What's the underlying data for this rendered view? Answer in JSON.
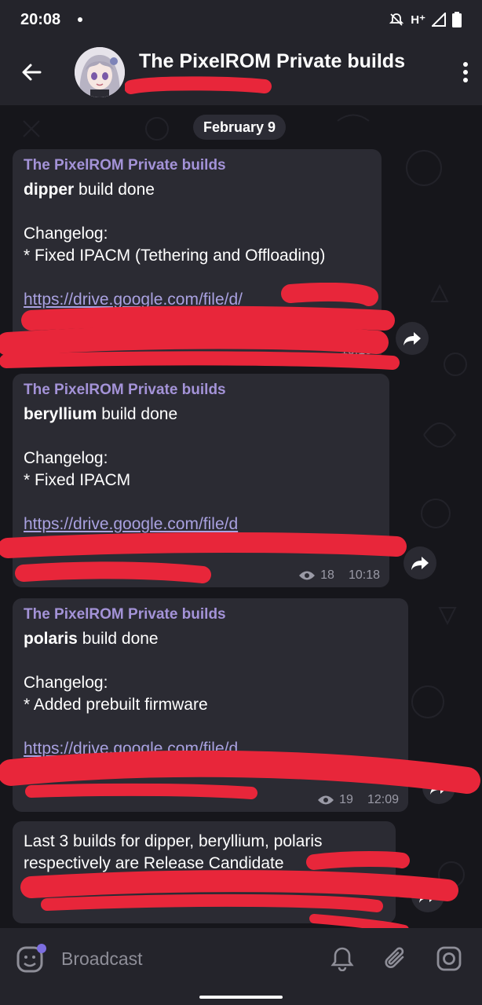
{
  "status_bar": {
    "time": "20:08",
    "network": "H⁺"
  },
  "header": {
    "title": "The PixelROM Private builds",
    "menu_icon": "more-vert-icon",
    "back_icon": "arrow-left-icon"
  },
  "chat": {
    "date_label": "February 9",
    "messages": [
      {
        "sender": "The PixelROM Private builds",
        "device": "dipper",
        "title_rest": " build done",
        "changelog_label": "Changelog:",
        "changelog_item": "* Fixed IPACM (Tethering and Offloading)",
        "link": "https://drive.google.com/file/d/",
        "time": "10:15"
      },
      {
        "sender": "The PixelROM Private builds",
        "device": "beryllium",
        "title_rest": " build done",
        "changelog_label": "Changelog:",
        "changelog_item": "* Fixed IPACM",
        "link": "https://drive.google.com/file/d",
        "views": "18",
        "time": "10:18"
      },
      {
        "sender": "The PixelROM Private builds",
        "device": "polaris",
        "title_rest": " build done",
        "changelog_label": "Changelog:",
        "changelog_item": "* Added prebuilt firmware",
        "link": "https://drive.google.com/file/d",
        "views": "19",
        "time": "12:09"
      },
      {
        "line1": "Last 3 builds for dipper, beryllium, polaris",
        "line2": "respectively are Release Candidate"
      }
    ]
  },
  "composer": {
    "placeholder": "Broadcast",
    "icons": [
      "sticker-icon",
      "bell-icon",
      "paperclip-icon",
      "camera-icon"
    ]
  },
  "colors": {
    "accent": "#a493d8",
    "link": "#a9a1e0",
    "bubble": "#2b2b33",
    "redaction": "#e8263a"
  }
}
